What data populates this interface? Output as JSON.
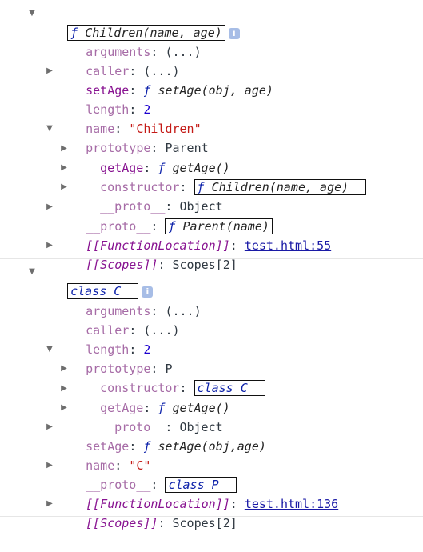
{
  "g1": {
    "header_prefix": "ƒ",
    "header_sig": "Children(name, age)",
    "info": "i",
    "arguments_key": "arguments",
    "arguments_val": "(...)",
    "caller_key": "caller",
    "caller_val": "(...)",
    "setAge_key": "setAge",
    "setAge_val": "setAge(obj, age)",
    "length_key": "length",
    "length_val": "2",
    "name_key": "name",
    "name_val": "\"Children\"",
    "prototype_key": "prototype",
    "prototype_val": "Parent",
    "getAge_key": "getAge",
    "getAge_val": "getAge()",
    "constructor_key": "constructor",
    "constructor_val": "Children(name, age)",
    "proto_inner_key": "__proto__",
    "proto_inner_val": "Object",
    "proto_key": "__proto__",
    "proto_val": "Parent(name)",
    "fnloc_key": "[[FunctionLocation]]",
    "fnloc_val": "test.html:55",
    "scopes_key": "[[Scopes]]",
    "scopes_val": "Scopes[2]"
  },
  "g2": {
    "header": "class C",
    "info": "i",
    "arguments_key": "arguments",
    "arguments_val": "(...)",
    "caller_key": "caller",
    "caller_val": "(...)",
    "length_key": "length",
    "length_val": "2",
    "prototype_key": "prototype",
    "prototype_val": "P",
    "constructor_key": "constructor",
    "constructor_val": "class C",
    "getAge_key": "getAge",
    "getAge_val": "getAge()",
    "proto_inner_key": "__proto__",
    "proto_inner_val": "Object",
    "setAge_key": "setAge",
    "setAge_val": "setAge(obj,age)",
    "name_key": "name",
    "name_val": "\"C\"",
    "proto_key": "__proto__",
    "proto_val": "class P",
    "fnloc_key": "[[FunctionLocation]]",
    "fnloc_val": "test.html:136",
    "scopes_key": "[[Scopes]]",
    "scopes_val": "Scopes[2]"
  },
  "common": {
    "colon": ": ",
    "fprefix": "ƒ ",
    "expand_open": "▼",
    "expand_closed": "▶"
  }
}
